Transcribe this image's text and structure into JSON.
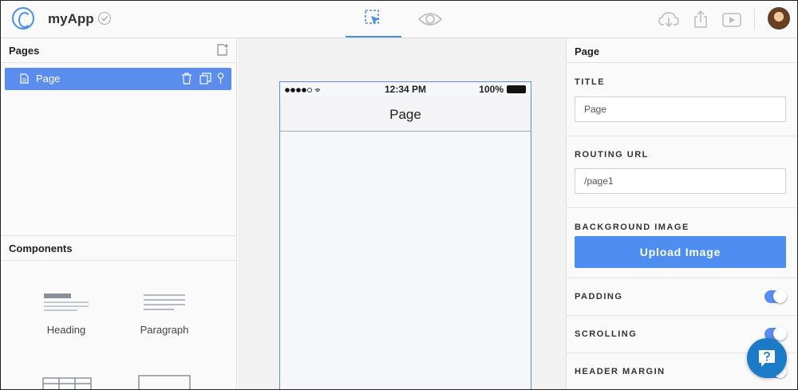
{
  "app": {
    "name": "myApp"
  },
  "pages_panel": {
    "title": "Pages",
    "items": [
      {
        "label": "Page"
      }
    ]
  },
  "components_panel": {
    "title": "Components",
    "items": [
      {
        "label": "Heading"
      },
      {
        "label": "Paragraph"
      }
    ]
  },
  "device": {
    "time": "12:34 PM",
    "battery": "100%",
    "nav_title": "Page"
  },
  "properties": {
    "header": "Page",
    "title_label": "TITLE",
    "title_value": "Page",
    "routing_label": "ROUTING URL",
    "routing_value": "/page1",
    "background_label": "BACKGROUND IMAGE",
    "upload_button": "Upload Image",
    "padding_label": "PADDING",
    "scrolling_label": "SCROLLING",
    "header_margin_label": "HEADER MARGIN"
  },
  "colors": {
    "accent": "#5b8def",
    "selected_row": "#5b8def",
    "help_button": "#1c7bc7"
  }
}
